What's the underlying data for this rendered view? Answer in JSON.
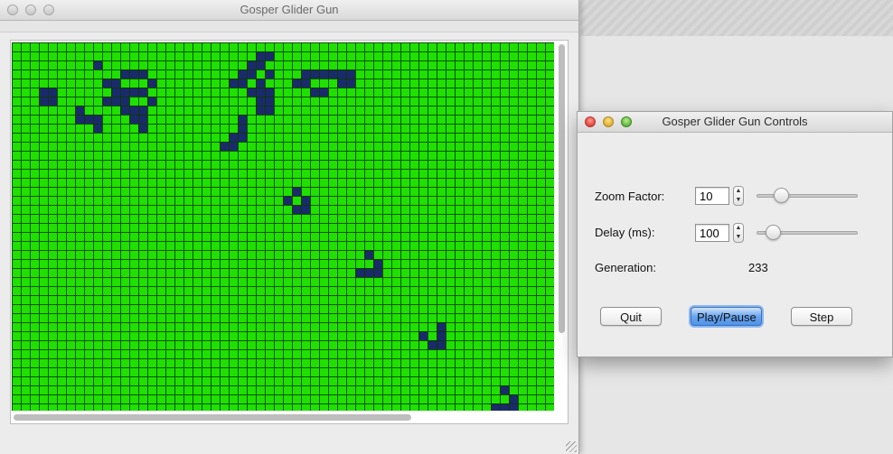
{
  "main_window": {
    "title": "Gosper Glider Gun",
    "grid": {
      "cols": 60,
      "visible_rows": 41,
      "alive_color": "#1a2b6b",
      "dead_color": "#1fe000",
      "line_color": "#0a3a00",
      "alive_cells": [
        [
          9,
          2
        ],
        [
          12,
          3
        ],
        [
          13,
          3
        ],
        [
          14,
          3
        ],
        [
          10,
          4
        ],
        [
          11,
          4
        ],
        [
          15,
          4
        ],
        [
          11,
          5
        ],
        [
          12,
          5
        ],
        [
          13,
          5
        ],
        [
          14,
          5
        ],
        [
          10,
          6
        ],
        [
          11,
          6
        ],
        [
          12,
          6
        ],
        [
          15,
          6
        ],
        [
          12,
          7
        ],
        [
          13,
          7
        ],
        [
          14,
          7
        ],
        [
          8,
          8
        ],
        [
          9,
          8
        ],
        [
          13,
          8
        ],
        [
          14,
          8
        ],
        [
          9,
          9
        ],
        [
          14,
          9
        ],
        [
          3,
          5
        ],
        [
          4,
          5
        ],
        [
          3,
          6
        ],
        [
          4,
          6
        ],
        [
          7,
          7
        ],
        [
          7,
          8
        ],
        [
          27,
          1
        ],
        [
          28,
          1
        ],
        [
          26,
          2
        ],
        [
          27,
          2
        ],
        [
          25,
          3
        ],
        [
          26,
          3
        ],
        [
          28,
          3
        ],
        [
          24,
          4
        ],
        [
          25,
          4
        ],
        [
          27,
          4
        ],
        [
          26,
          5
        ],
        [
          27,
          5
        ],
        [
          28,
          5
        ],
        [
          27,
          6
        ],
        [
          28,
          6
        ],
        [
          27,
          7
        ],
        [
          28,
          7
        ],
        [
          32,
          3
        ],
        [
          33,
          3
        ],
        [
          34,
          3
        ],
        [
          35,
          3
        ],
        [
          36,
          3
        ],
        [
          37,
          3
        ],
        [
          31,
          4
        ],
        [
          32,
          4
        ],
        [
          36,
          4
        ],
        [
          37,
          4
        ],
        [
          33,
          5
        ],
        [
          34,
          5
        ],
        [
          25,
          8
        ],
        [
          25,
          9
        ],
        [
          24,
          10
        ],
        [
          25,
          10
        ],
        [
          23,
          11
        ],
        [
          24,
          11
        ],
        [
          31,
          16
        ],
        [
          32,
          17
        ],
        [
          32,
          18
        ],
        [
          30,
          17
        ],
        [
          31,
          18
        ],
        [
          39,
          23
        ],
        [
          40,
          24
        ],
        [
          38,
          25
        ],
        [
          39,
          25
        ],
        [
          40,
          25
        ],
        [
          47,
          31
        ],
        [
          45,
          32
        ],
        [
          47,
          32
        ],
        [
          46,
          33
        ],
        [
          47,
          33
        ],
        [
          54,
          38
        ],
        [
          55,
          39
        ],
        [
          53,
          40
        ],
        [
          54,
          40
        ],
        [
          55,
          40
        ]
      ]
    }
  },
  "controls_window": {
    "title": "Gosper Glider Gun Controls",
    "zoom": {
      "label": "Zoom Factor:",
      "value": "10",
      "slider_fraction": 0.2
    },
    "delay": {
      "label": "Delay (ms):",
      "value": "100",
      "slider_fraction": 0.1
    },
    "generation": {
      "label": "Generation:",
      "value": "233"
    },
    "buttons": {
      "quit": "Quit",
      "play_pause": "Play/Pause",
      "step": "Step"
    }
  }
}
